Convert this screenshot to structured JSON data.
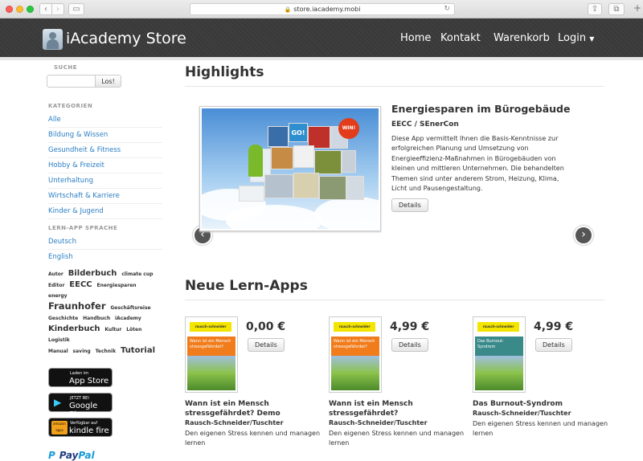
{
  "browser": {
    "url": "store.iacademy.mobi"
  },
  "header": {
    "brand": "iAcademy Store",
    "nav": [
      "Home",
      "Kontakt",
      "Warenkorb",
      "Login"
    ]
  },
  "sidebar": {
    "search_heading": "SUCHE",
    "search_button": "Los!",
    "search_value": "",
    "categories_heading": "KATEGORIEN",
    "categories": [
      "Alle",
      "Bildung & Wissen",
      "Gesundheit & Fitness",
      "Hobby & Freizeit",
      "Unterhaltung",
      "Wirtschaft & Karriere",
      "Kinder & Jugend"
    ],
    "language_heading": "LERN-APP SPRACHE",
    "languages": [
      "Deutsch",
      "English"
    ],
    "tags": [
      {
        "text": "Autor",
        "size": "s"
      },
      {
        "text": "Bilderbuch",
        "size": "l"
      },
      {
        "text": "climate cup",
        "size": "s"
      },
      {
        "text": "Editor",
        "size": "s"
      },
      {
        "text": "EECC",
        "size": "l"
      },
      {
        "text": "Energiesparen",
        "size": "s"
      },
      {
        "text": "energy",
        "size": "s"
      },
      {
        "text": "Fraunhofer",
        "size": "xl"
      },
      {
        "text": "Geschäftsreise",
        "size": "s"
      },
      {
        "text": "Geschichte",
        "size": "s"
      },
      {
        "text": "Handbuch",
        "size": "s"
      },
      {
        "text": "iAcademy",
        "size": "s"
      },
      {
        "text": "Kinderbuch",
        "size": "l"
      },
      {
        "text": "Kultur",
        "size": "s"
      },
      {
        "text": "Löten",
        "size": "s"
      },
      {
        "text": "Logistik",
        "size": "s"
      },
      {
        "text": "Manual",
        "size": "s"
      },
      {
        "text": "saving",
        "size": "s"
      },
      {
        "text": "Technik",
        "size": "s"
      },
      {
        "text": "Tutorial",
        "size": "l"
      }
    ],
    "badges": {
      "appstore_small": "Laden im",
      "appstore_big": "App Store",
      "googleplay_small": "JETZT BEI",
      "googleplay_big": "Google Play",
      "amazon_logo": "amazon apps",
      "amazon_small": "Verfügbar auf",
      "amazon_big": "kindle fire"
    },
    "paypal_pay": "Pay",
    "paypal_pal": "Pal"
  },
  "highlights": {
    "heading": "Highlights",
    "title": "Energiesparen im Bürogebäude",
    "subtitle": "EECC / SEnerCon",
    "description": "Diese App vermittelt Ihnen die Basis-Kenntnisse zur erfolgreichen Planung und Umsetzung von Energieeffizienz-Maßnahmen in Bürogebäuden von kleinen und mittleren Unternehmen. Die behandelten Themen sind unter anderem Strom, Heizung, Klima, Licht und Pausengestaltung.",
    "button": "Details",
    "art_go": "GO!",
    "art_win": "WIN!"
  },
  "new_apps": {
    "heading": "Neue Lern-Apps",
    "items": [
      {
        "price": "0,00 €",
        "button": "Details",
        "title": "Wann ist ein Mensch stressgefährdet? Demo",
        "author": "Rausch-Schneider/Tuschter",
        "desc": "Den eigenen Stress kennen und managen lernen",
        "cover_logo": "rausch-schneider",
        "cover_text": "Wann ist ein Mensch stressgefährdet?",
        "band_color": "#f07c1c"
      },
      {
        "price": "4,99 €",
        "button": "Details",
        "title": "Wann ist ein Mensch stressgefährdet?",
        "author": "Rausch-Schneider/Tuschter",
        "desc": "Den eigenen Stress kennen und managen lernen",
        "cover_logo": "rausch-schneider",
        "cover_text": "Wann ist ein Mensch stressgefährdet?",
        "band_color": "#f07c1c"
      },
      {
        "price": "4,99 €",
        "button": "Details",
        "title": "Das Burnout-Syndrom",
        "author": "Rausch-Schneider/Tuschter",
        "desc": "Den eigenen Stress kennen und managen lernen",
        "cover_logo": "rausch-schneider",
        "cover_text": "Das Burnout-Syndrom",
        "band_color": "#3a8a8a"
      }
    ]
  }
}
